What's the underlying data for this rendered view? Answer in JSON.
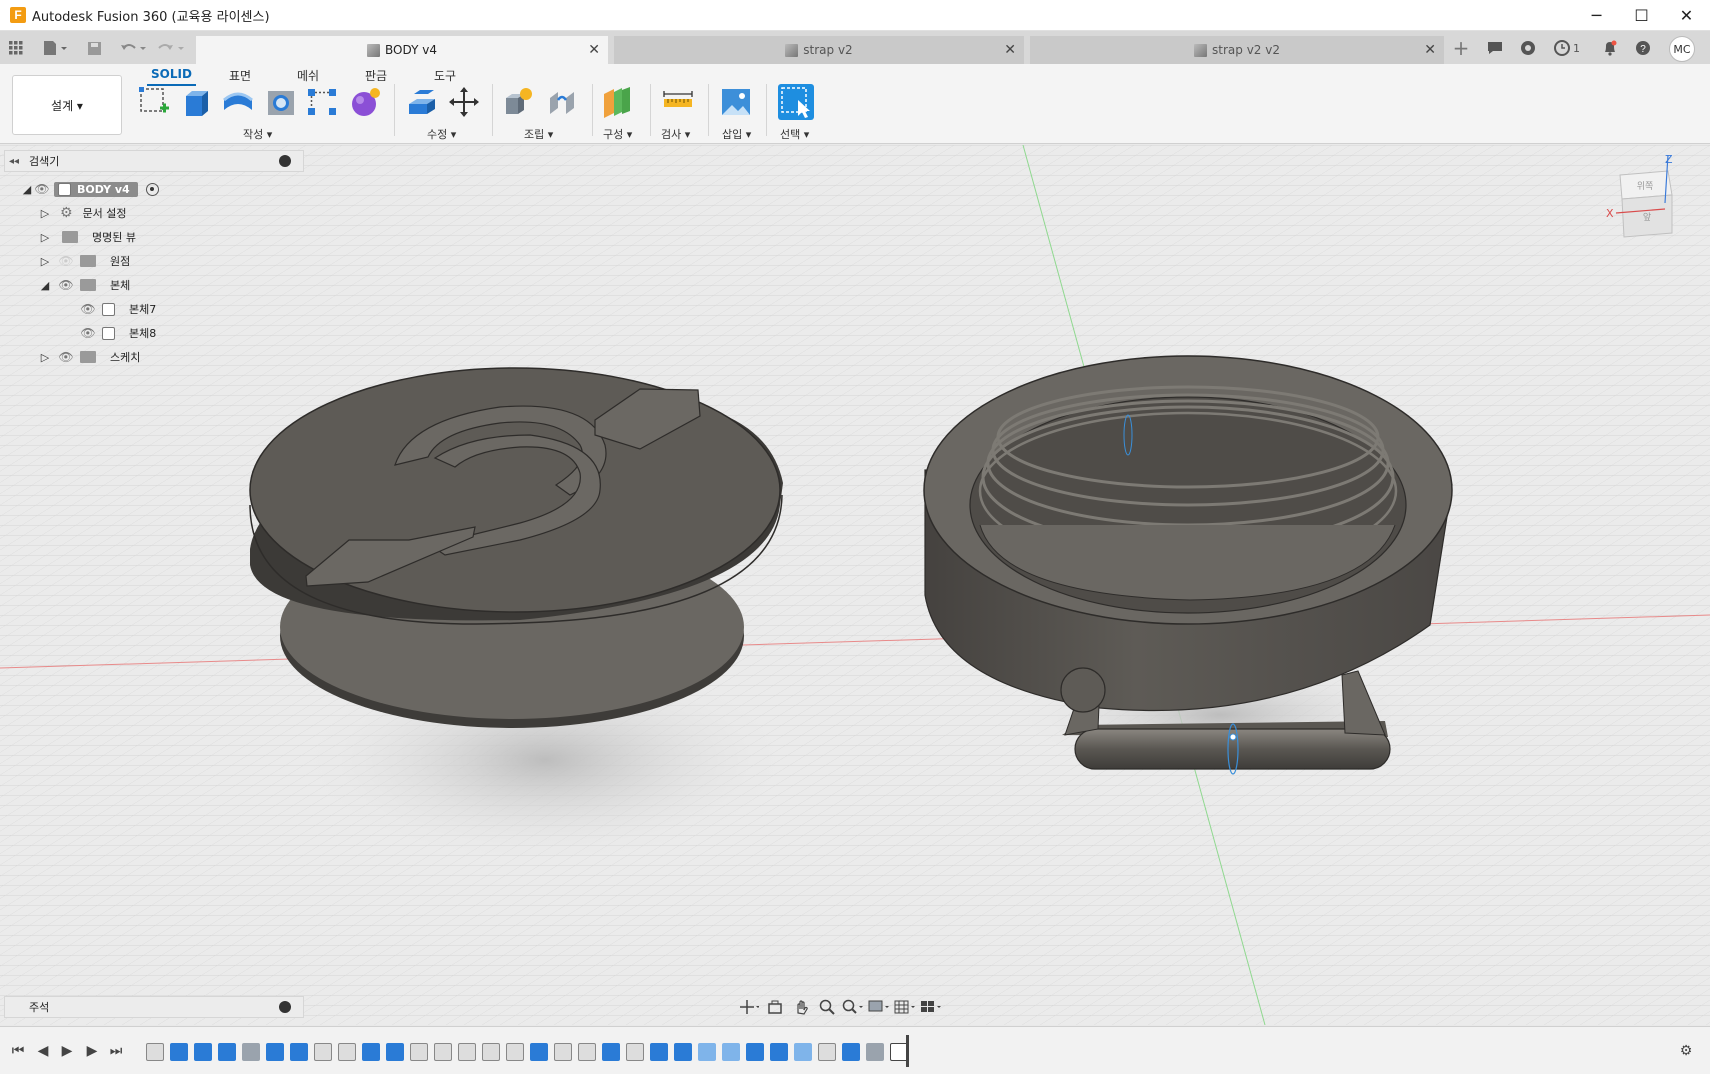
{
  "window": {
    "title": "Autodesk Fusion 360 (교육용 라이센스)",
    "logo_letter": "F",
    "minimize_glyph": "─",
    "maximize_glyph": "☐",
    "close_glyph": "✕"
  },
  "tabs": [
    {
      "label": "BODY v4",
      "active": true
    },
    {
      "label": "strap v2",
      "active": false
    },
    {
      "label": "strap v2 v2",
      "active": false
    }
  ],
  "tab_close_glyph": "✕",
  "tab_add_glyph": "+",
  "header_right": {
    "job_count": "1",
    "user_initials": "MC"
  },
  "toolbar": {
    "workspace": "설계 ▾",
    "ws_tabs": [
      "SOLID",
      "표면",
      "메쉬",
      "판금",
      "도구"
    ],
    "groups": [
      "작성 ▾",
      "수정 ▾",
      "조립 ▾",
      "구성 ▾",
      "검사 ▾",
      "삽입 ▾",
      "선택 ▾"
    ]
  },
  "browser": {
    "header": "검색기",
    "root": "BODY v4",
    "items": [
      {
        "label": "문서 설정"
      },
      {
        "label": "명명된 뷰"
      },
      {
        "label": "원점"
      },
      {
        "label": "본체"
      },
      {
        "label": "본체7"
      },
      {
        "label": "본체8"
      },
      {
        "label": "스케치"
      }
    ]
  },
  "viewcube": {
    "top_face": "위쪽",
    "front_face": "앞",
    "z_label": "Z",
    "x_label": "X"
  },
  "comments": {
    "label": "주석"
  },
  "colors": {
    "accent": "#0a6ab7",
    "model": "#5e5b56",
    "grid": "#d4d4d4"
  }
}
